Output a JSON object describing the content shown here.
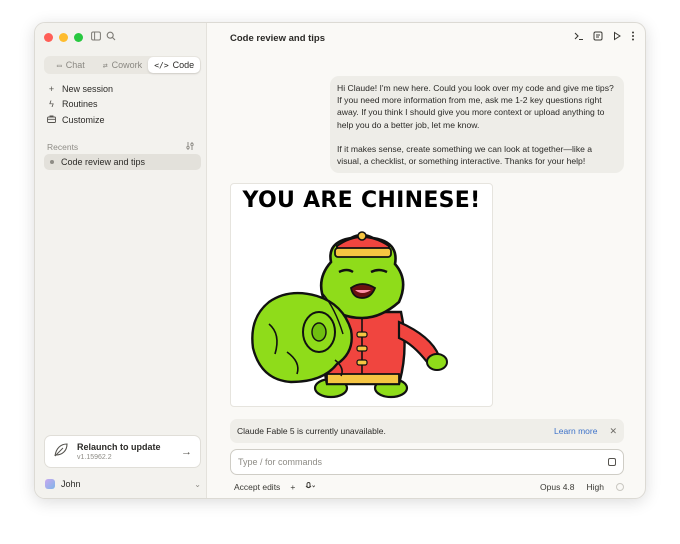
{
  "window": {
    "traffic_colors": [
      "#ff5f57",
      "#febc2e",
      "#28c840"
    ]
  },
  "sidebar": {
    "toggle_icon": "sidebar-icon",
    "search_icon": "search-icon",
    "modes": [
      {
        "label": "Chat",
        "icon": "chat-icon",
        "active": false
      },
      {
        "label": "Cowork",
        "icon": "cowork-icon",
        "active": false
      },
      {
        "label": "Code",
        "icon": "code-icon",
        "active": true
      }
    ],
    "nav": [
      {
        "label": "New session",
        "icon": "plus-icon"
      },
      {
        "label": "Routines",
        "icon": "bolt-icon"
      },
      {
        "label": "Customize",
        "icon": "briefcase-icon"
      }
    ],
    "recents_label": "Recents",
    "recents": [
      {
        "label": "Code review and tips",
        "active": true
      }
    ],
    "update": {
      "title": "Relaunch to update",
      "version": "v1.15962.2"
    },
    "user": {
      "name": "John"
    }
  },
  "main": {
    "title": "Code review and tips",
    "header_icons": [
      "terminal-icon",
      "panel-icon",
      "play-icon",
      "more-icon"
    ],
    "user_message": {
      "p1": "Hi Claude! I'm new here. Could you look over my code and give me tips? If you need more information from me, ask me 1-2 key questions right away. If you think I should give you more context or upload anything to help you do a better job, let me know.",
      "p2": "If it makes sense, create something we can look at together—like a visual, a checklist, or something interactive. Thanks for your help!"
    },
    "image": {
      "caption": "YOU ARE CHINESE!"
    },
    "notice": {
      "text": "Claude Fable 5 is currently unavailable.",
      "link": "Learn more"
    },
    "composer": {
      "placeholder": "Type / for commands",
      "value": ""
    },
    "bottom": {
      "mode": "Accept edits",
      "model": "Opus 4.8",
      "effort": "High"
    }
  }
}
